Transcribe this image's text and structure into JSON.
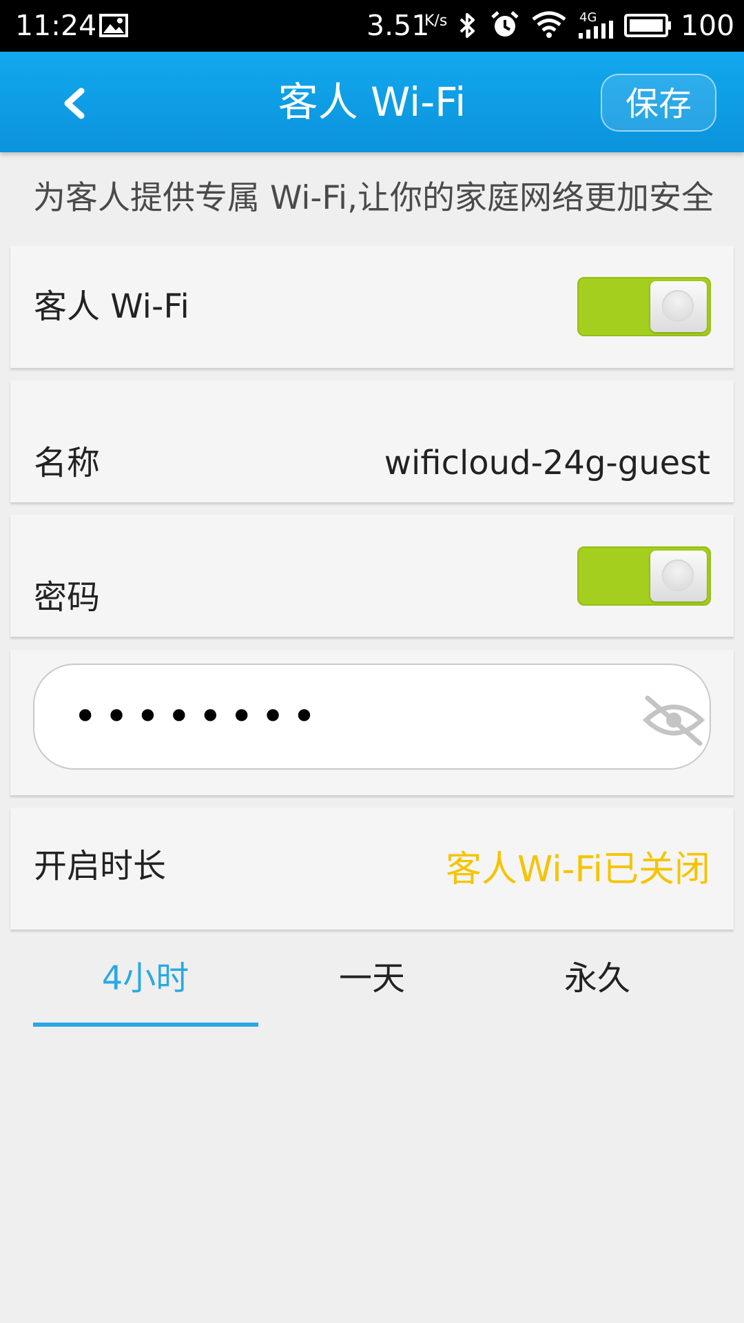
{
  "status_bar": {
    "time": "11:24",
    "speed": "3.51",
    "speed_unit": "K/s",
    "network_type": "4G",
    "battery": "100",
    "icons": [
      "image-icon",
      "bluetooth-icon",
      "alarm-icon",
      "wifi-icon",
      "signal-icon",
      "battery-icon"
    ]
  },
  "header": {
    "title": "客人 Wi-Fi",
    "save_label": "保存",
    "back_icon": "chevron-left-icon"
  },
  "subtitle": "为客人提供专属 Wi-Fi,让你的家庭网络更加安全",
  "settings": {
    "guest_wifi": {
      "label": "客人 Wi-Fi",
      "enabled": true
    },
    "name": {
      "label": "名称",
      "value": "wificloud-24g-guest"
    },
    "password": {
      "label": "密码",
      "enabled": true,
      "masked_value": "••••••••",
      "eye_icon": "eye-off-icon"
    },
    "duration": {
      "label": "开启时长",
      "status": "客人Wi-Fi已关闭"
    }
  },
  "duration_tabs": [
    {
      "label": "4小时",
      "active": true
    },
    {
      "label": "一天",
      "active": false
    },
    {
      "label": "永久",
      "active": false
    }
  ],
  "colors": {
    "header_blue": "#0b93dc",
    "toggle_green": "#a4cf1e",
    "status_yellow": "#f5c400",
    "active_tab_blue": "#2aa8e2"
  }
}
